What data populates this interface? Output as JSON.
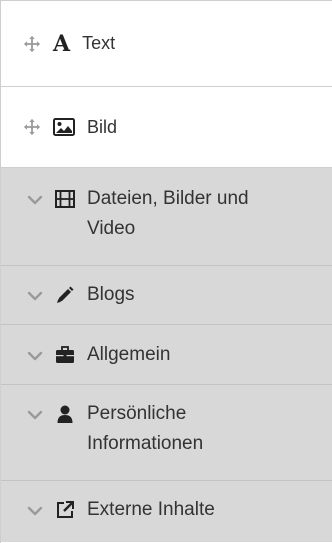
{
  "blocks": [
    {
      "label": "Text",
      "icon": "serif-a-icon"
    },
    {
      "label": "Bild",
      "icon": "image-icon"
    }
  ],
  "groups": [
    {
      "lines": [
        "Dateien, Bilder und",
        "Video"
      ],
      "icon": "film-icon"
    },
    {
      "lines": [
        "Blogs"
      ],
      "icon": "pencil-icon"
    },
    {
      "lines": [
        "Allgemein"
      ],
      "icon": "briefcase-icon"
    },
    {
      "lines": [
        "Persönliche",
        "Informationen"
      ],
      "icon": "user-icon"
    },
    {
      "lines": [
        "Externe Inhalte"
      ],
      "icon": "external-link-icon"
    }
  ],
  "text_icon_glyph": "A"
}
